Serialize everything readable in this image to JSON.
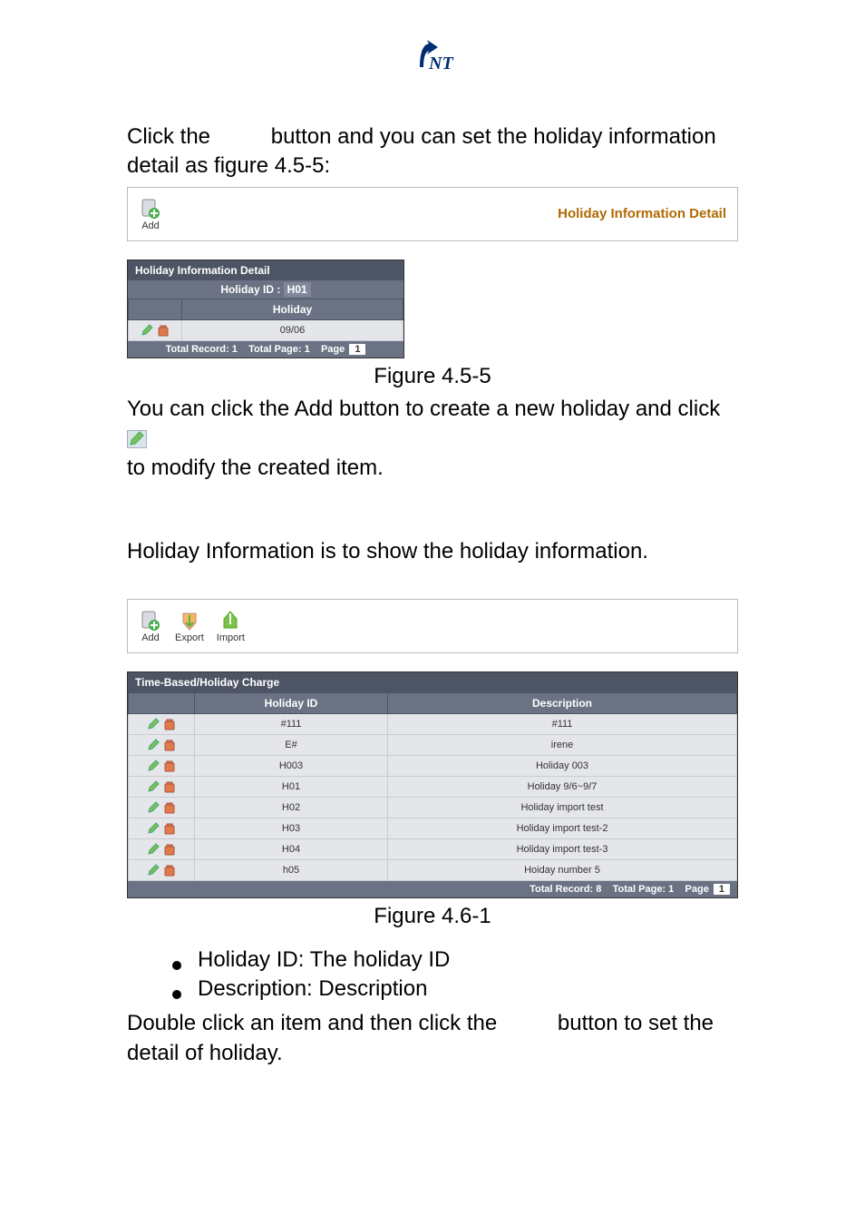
{
  "logo": {
    "name": "brand-fnt-icon"
  },
  "intro1a": "Click the ",
  "intro1b": "button and you can set the holiday information detail as figure 4.5-5:",
  "panel1": {
    "add_label": "Add",
    "title_right": "Holiday Information Detail"
  },
  "grid1": {
    "title": "Holiday Information Detail",
    "hid_label": "Holiday ID : ",
    "hid_value": "H01",
    "col1": "Holiday",
    "row1_val": "09/06",
    "footer_total_record": "Total Record: ",
    "footer_total_record_val": "1",
    "footer_total_page": "Total Page: ",
    "footer_total_page_val": "1",
    "footer_page_label": "Page",
    "footer_page_val": "1"
  },
  "fig1_label": "Figure 4.5-5",
  "after1a": "You can click the Add button to create a new holiday and click ",
  "after1b": "to modify the created item.",
  "section2_intro": "Holiday Information is to show the holiday information.",
  "panel2": {
    "add_label": "Add",
    "export_label": "Export",
    "import_label": "Import"
  },
  "grid2": {
    "title": "Time-Based/Holiday Charge",
    "col_holiday_id": "Holiday ID",
    "col_description": "Description",
    "footer_total_record": "Total Record: ",
    "footer_total_record_val": "8",
    "footer_total_page": "Total Page: ",
    "footer_total_page_val": "1",
    "footer_page_label": "Page",
    "footer_page_val": "1"
  },
  "chart_data": {
    "type": "table",
    "columns": [
      "Holiday ID",
      "Description"
    ],
    "rows": [
      {
        "id": "#111",
        "desc": "#111"
      },
      {
        "id": "E#",
        "desc": "irene"
      },
      {
        "id": "H003",
        "desc": "Holiday 003"
      },
      {
        "id": "H01",
        "desc": "Holiday 9/6~9/7"
      },
      {
        "id": "H02",
        "desc": "Holiday import test"
      },
      {
        "id": "H03",
        "desc": "Holiday import test-2"
      },
      {
        "id": "H04",
        "desc": "Holiday import test-3"
      },
      {
        "id": "h05",
        "desc": "Hoiday number 5"
      }
    ]
  },
  "fig2_label": "Figure 4.6-1",
  "bullets": {
    "b1": "Holiday ID: The holiday ID",
    "b2": "Description: Description"
  },
  "closing_a": "Double click an item and then click the ",
  "closing_b": "button to set the detail of holiday."
}
